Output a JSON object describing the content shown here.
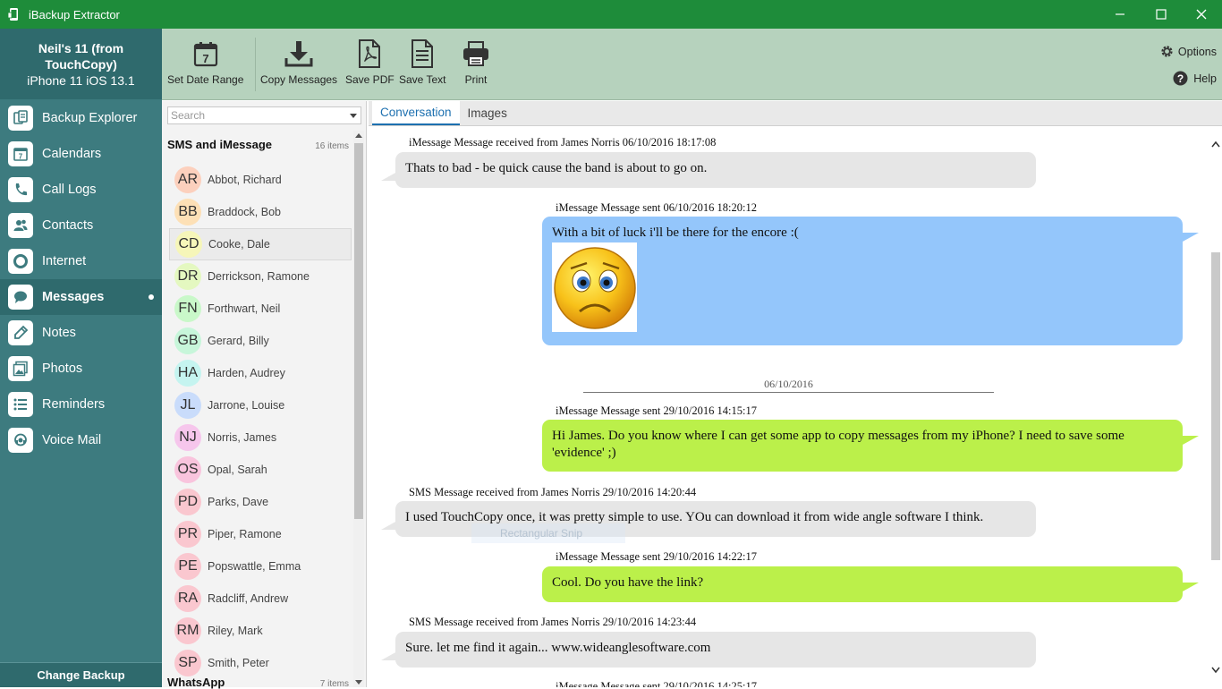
{
  "window": {
    "title": "iBackup Extractor",
    "controls": {
      "minimize": "—",
      "maximize": "☐",
      "close": "✕"
    }
  },
  "device": {
    "name": "Neil's 11 (from TouchCopy)",
    "model": "iPhone 11 iOS 13.1"
  },
  "nav": [
    {
      "label": "Backup Explorer",
      "icon": "backup-explorer-icon"
    },
    {
      "label": "Calendars",
      "icon": "calendar-icon"
    },
    {
      "label": "Call Logs",
      "icon": "phone-icon"
    },
    {
      "label": "Contacts",
      "icon": "contacts-icon"
    },
    {
      "label": "Internet",
      "icon": "internet-icon"
    },
    {
      "label": "Messages",
      "icon": "messages-icon",
      "active": true
    },
    {
      "label": "Notes",
      "icon": "notes-icon"
    },
    {
      "label": "Photos",
      "icon": "photos-icon"
    },
    {
      "label": "Reminders",
      "icon": "reminders-icon"
    },
    {
      "label": "Voice Mail",
      "icon": "voicemail-icon"
    }
  ],
  "change_backup": "Change Backup",
  "toolbar": {
    "set_date_range": "Set Date Range",
    "date_icon_day": "7",
    "copy_messages": "Copy Messages",
    "save_pdf": "Save PDF",
    "save_text": "Save Text",
    "print": "Print",
    "options": "Options",
    "help": "Help"
  },
  "search": {
    "placeholder": "Search"
  },
  "groups": {
    "sms": {
      "name": "SMS and iMessage",
      "count": "16 items"
    },
    "whatsapp": {
      "name": "WhatsApp",
      "count": "7 items"
    }
  },
  "contacts": [
    {
      "initials": "AR",
      "name": "Abbot, Richard",
      "color": "#fcd0bd"
    },
    {
      "initials": "BB",
      "name": "Braddock, Bob",
      "color": "#fde0b6"
    },
    {
      "initials": "CD",
      "name": "Cooke, Dale",
      "color": "#f6f6b9",
      "selected": true
    },
    {
      "initials": "DR",
      "name": "Derrickson, Ramone",
      "color": "#e4f8c0"
    },
    {
      "initials": "FN",
      "name": "Forthwart, Neil",
      "color": "#c9f8c9"
    },
    {
      "initials": "GB",
      "name": "Gerard, Billy",
      "color": "#c7f6da"
    },
    {
      "initials": "HA",
      "name": "Harden, Audrey",
      "color": "#c5f4f0"
    },
    {
      "initials": "JL",
      "name": "Jarrone, Louise",
      "color": "#c9dcfb"
    },
    {
      "initials": "NJ",
      "name": "Norris, James",
      "color": "#f6c6ec"
    },
    {
      "initials": "OS",
      "name": "Opal, Sarah",
      "color": "#f9c4dd"
    },
    {
      "initials": "PD",
      "name": "Parks, Dave",
      "color": "#fac7cf"
    },
    {
      "initials": "PR",
      "name": "Piper, Ramone",
      "color": "#fac7cf"
    },
    {
      "initials": "PE",
      "name": "Popswattle, Emma",
      "color": "#fac7cf"
    },
    {
      "initials": "RA",
      "name": "Radcliff, Andrew",
      "color": "#fac7cf"
    },
    {
      "initials": "RM",
      "name": "Riley, Mark",
      "color": "#fac7cf"
    },
    {
      "initials": "SP",
      "name": "Smith, Peter",
      "color": "#fac7cf"
    }
  ],
  "tabs": {
    "conversation": "Conversation",
    "images": "Images"
  },
  "messages": [
    {
      "meta": "iMessage Message received from James Norris 06/10/2016 18:17:08",
      "text": "Thats to bad - be quick cause the band is about to go on."
    },
    {
      "meta": "iMessage Message sent 06/10/2016 18:20:12",
      "text": "With a bit of luck i'll be there for the encore :("
    },
    {
      "meta": "iMessage Message sent 29/10/2016 14:15:17",
      "text": "Hi James. Do you know where I can get some app to copy messages from my iPhone? I need to save some 'evidence' ;)"
    },
    {
      "meta": "SMS Message received from James Norris 29/10/2016 14:20:44",
      "text": "I used TouchCopy once, it was pretty simple to use. YOu can download it from wide angle software I think."
    },
    {
      "meta": "iMessage Message sent 29/10/2016 14:22:17",
      "text": "Cool. Do you have the link?"
    },
    {
      "meta": "SMS Message received from James Norris 29/10/2016 14:23:44",
      "text": "Sure. let me find it again... www.wideanglesoftware.com"
    },
    {
      "meta": "iMessage Message sent 29/10/2016 14:25:17",
      "text": ""
    }
  ],
  "date_separator": "06/10/2016",
  "snip_overlay": "Rectangular Snip",
  "colors": {
    "titlebar": "#1e8c3a",
    "sidebar": "#3d7b7f",
    "toolbar": "#b6d2bd",
    "sent_blue": "#94c6fb",
    "sent_green": "#bbf04a",
    "received": "#e6e6e6",
    "tab_active": "#1d70b0"
  }
}
